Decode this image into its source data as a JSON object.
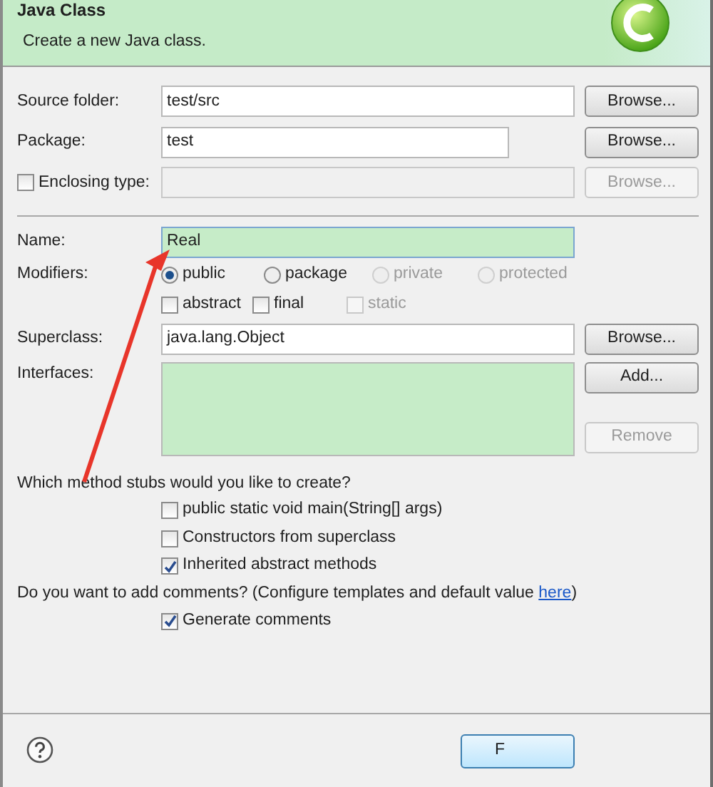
{
  "dialog": {
    "title": "Java Class",
    "subtitle": "Create a new Java class."
  },
  "source_folder": {
    "label": "Source folder:",
    "value": "test/src",
    "button": "Browse..."
  },
  "package": {
    "label": "Package:",
    "value": "test",
    "button": "Browse..."
  },
  "enclosing_type": {
    "label": "Enclosing type:",
    "checked": false,
    "disabled": true,
    "button": "Browse..."
  },
  "name": {
    "label": "Name:",
    "value": "Real"
  },
  "modifiers": {
    "label": "Modifiers:",
    "access": [
      {
        "label": "public",
        "selected": true,
        "disabled": false
      },
      {
        "label": "package",
        "selected": false,
        "disabled": false
      },
      {
        "label": "private",
        "selected": false,
        "disabled": true
      },
      {
        "label": "protected",
        "selected": false,
        "disabled": true
      }
    ],
    "flags": [
      {
        "label": "abstract",
        "checked": false,
        "disabled": false
      },
      {
        "label": "final",
        "checked": false,
        "disabled": false
      },
      {
        "label": "static",
        "checked": false,
        "disabled": true
      }
    ]
  },
  "superclass": {
    "label": "Superclass:",
    "value": "java.lang.Object",
    "button": "Browse..."
  },
  "interfaces": {
    "label": "Interfaces:",
    "buttons": [
      {
        "label": "Add...",
        "disabled": false
      },
      {
        "label": "Remove",
        "disabled": true
      }
    ]
  },
  "stubs": {
    "question": "Which method stubs would you like to create?",
    "options": [
      {
        "label": "public static void main(String[] args)",
        "checked": false
      },
      {
        "label": "Constructors from superclass",
        "checked": false
      },
      {
        "label": "Inherited abstract methods",
        "checked": true
      }
    ]
  },
  "comments": {
    "question_before": "Do you want to add comments? (Configure templates and default value ",
    "link": "here",
    "question_after": ")",
    "options": [
      {
        "label": "Generate comments",
        "checked": true
      }
    ]
  },
  "footer": {
    "finish_button": "F"
  }
}
